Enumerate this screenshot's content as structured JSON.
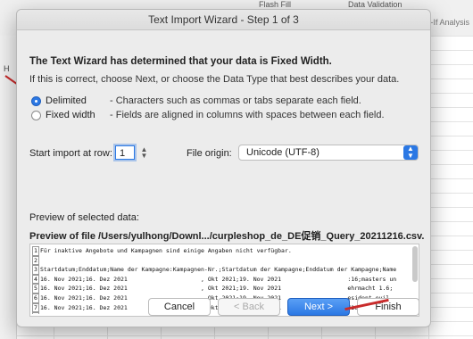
{
  "background": {
    "toolbar_fragments": [
      "Flash Fill",
      "Data Validation"
    ],
    "side_label": "What-If Analysis",
    "row_label": "H"
  },
  "dialog": {
    "title": "Text Import Wizard - Step 1 of 3",
    "heading": "The Text Wizard has determined that your data is Fixed Width.",
    "subtext": "If this is correct, choose Next, or choose the Data Type that best describes your data.",
    "options": [
      {
        "label": "Delimited",
        "desc": "- Characters such as commas or tabs separate each field.",
        "checked": true
      },
      {
        "label": "Fixed width",
        "desc": "- Fields are aligned in columns with spaces between each field.",
        "checked": false
      }
    ],
    "start_row_label": "Start import at row:",
    "start_row_value": "1",
    "file_origin_label": "File origin:",
    "file_origin_value": "Unicode (UTF-8)",
    "preview_label": "Preview of selected data:",
    "preview_file": "Preview of file /Users/yulhong/Downl.../curpleshop_de_DE促销_Query_20211216.csv.",
    "preview_lines": [
      {
        "n": "1",
        "text": "Für inaktive Angebote und Kampagnen sind einige Angaben nicht verfügbar."
      },
      {
        "n": "2",
        "text": ""
      },
      {
        "n": "3",
        "text": "Startdatum;Enddatum;Name der Kampagne:Kampagnen-Nr.;Startdatum der Kampagne;Enddatum der Kampagne;Name"
      },
      {
        "n": "4",
        "text": "16. Nov 2021;16. Dez 2021                     , Okt 2021;19. Nov 2021                   :16;masters un"
      },
      {
        "n": "5",
        "text": "16. Nov 2021;16. Dez 2021                     , Okt 2021;19. Nov 2021                   ehrmacht 1.6;"
      },
      {
        "n": "6",
        "text": "16. Nov 2021;16. Dez 2021                     , Okt 2021;19. Nov 2021                   esident evil"
      },
      {
        "n": "7",
        "text": "16. Nov 2021;16. Dez 2021                     , Okt 2021;19. Nov 2021                   /16 stockings;"
      },
      {
        "n": "8",
        "text": "16. Nov 2021;16. Dez 2021                     , Okt 2021;19. Nov 2021                   ot toys predo"
      }
    ],
    "buttons": {
      "cancel": "Cancel",
      "back": "< Back",
      "next": "Next >",
      "finish": "Finish"
    }
  }
}
